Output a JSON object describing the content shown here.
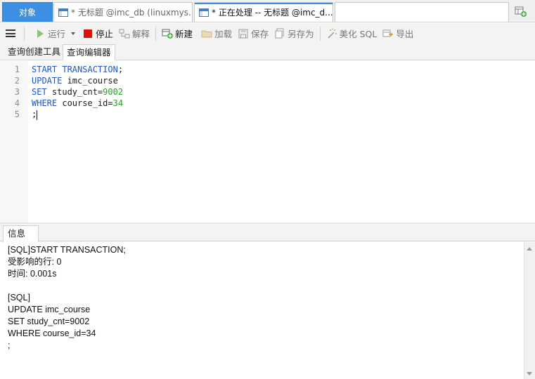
{
  "tabs": {
    "objects_label": "对象",
    "tab1_label": "* 无标题 @imc_db (linuxmys...",
    "tab2_label": "* 正在处理 -- 无标题 @imc_d..."
  },
  "toolbar": {
    "run": "运行",
    "stop": "停止",
    "explain": "解释",
    "new": "新建",
    "load": "加载",
    "save": "保存",
    "save_as": "另存为",
    "beautify": "美化 SQL",
    "export": "导出"
  },
  "subtabs": {
    "builder": "查询创建工具",
    "editor": "查询编辑器"
  },
  "editor": {
    "lines": [
      {
        "no": "1",
        "kw": "START TRANSACTION",
        "rest": ";",
        "num": ""
      },
      {
        "no": "2",
        "kw": "UPDATE",
        "rest": " imc_course",
        "num": ""
      },
      {
        "no": "3",
        "kw": "SET",
        "rest": " study_cnt=",
        "num": "9002"
      },
      {
        "no": "4",
        "kw": "WHERE",
        "rest": " course_id=",
        "num": "34"
      },
      {
        "no": "5",
        "kw": "",
        "rest": ";",
        "num": ""
      }
    ]
  },
  "info": {
    "tab_label": "信息",
    "lines": [
      "[SQL]START TRANSACTION;",
      "受影响的行: 0",
      "时间: 0.001s",
      "",
      "[SQL]",
      "UPDATE imc_course",
      "SET study_cnt=9002",
      "WHERE course_id=34",
      ";"
    ]
  },
  "colors": {
    "accent": "#3c8fe3",
    "keyword": "#1f54c8",
    "number": "#2d9a2d",
    "stop": "#d9120f"
  }
}
